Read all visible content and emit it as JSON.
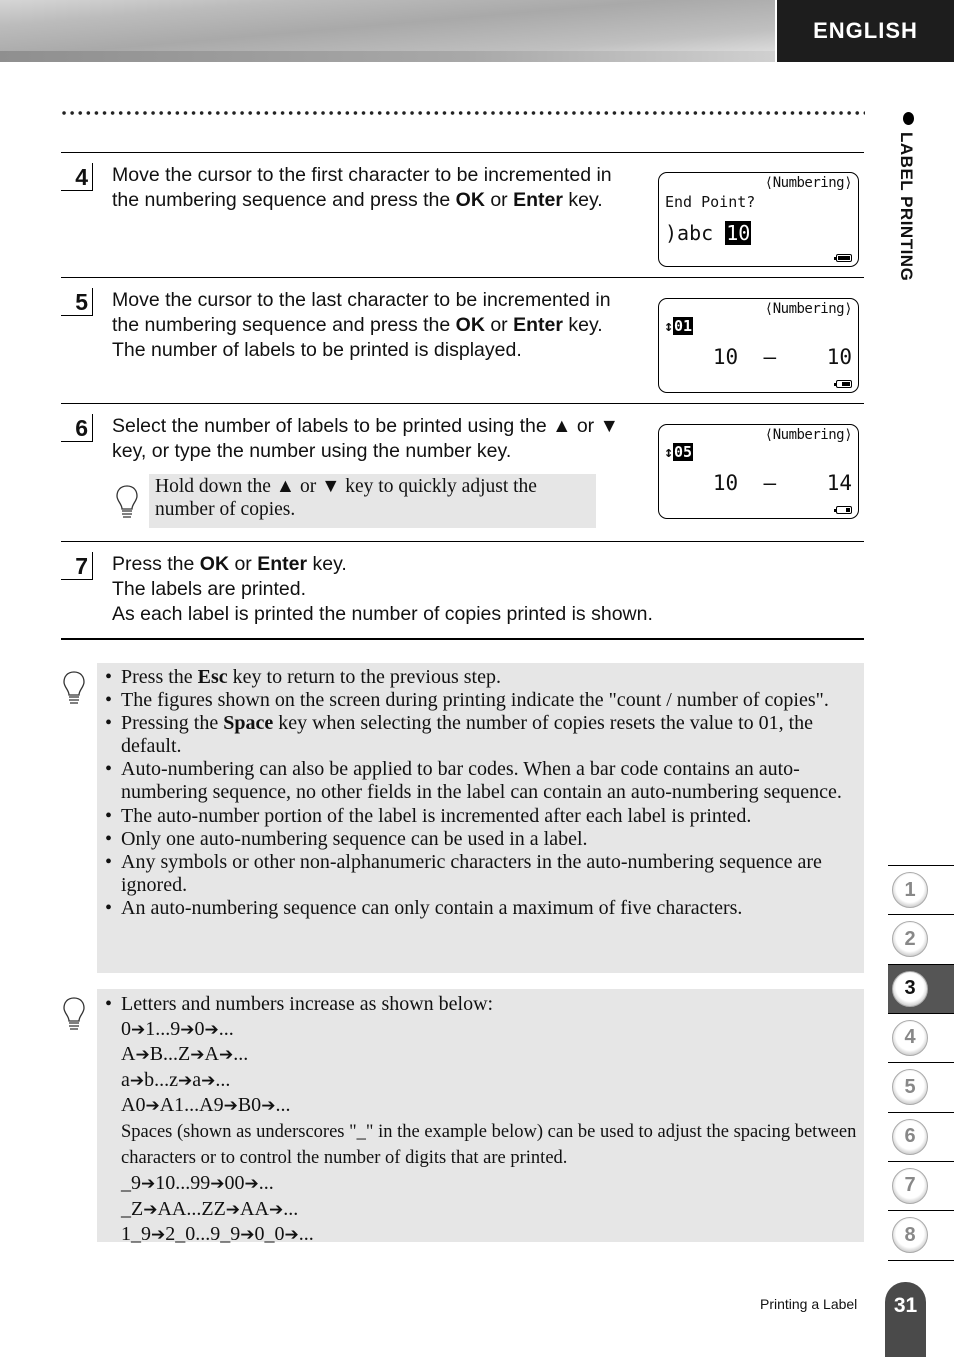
{
  "header": {
    "language_label": "ENGLISH"
  },
  "side": {
    "section_title": "LABEL PRINTING"
  },
  "steps": [
    {
      "number": "4",
      "lines": [
        {
          "parts": [
            {
              "t": "Move the cursor to the first character to be incremented in"
            }
          ]
        },
        {
          "parts": [
            {
              "t": "the numbering sequence and press the "
            },
            {
              "t": "OK",
              "b": true
            },
            {
              "t": " or "
            },
            {
              "t": "Enter",
              "b": true
            },
            {
              "t": " key."
            }
          ]
        }
      ],
      "lcd": {
        "mode": "⟨Numbering⟩",
        "line1": "End Point?",
        "line2_prefix": ")abc ",
        "line2_highlight": "10",
        "battery": "full"
      }
    },
    {
      "number": "5",
      "lines": [
        {
          "parts": [
            {
              "t": "Move the cursor to the last character to be incremented in"
            }
          ]
        },
        {
          "parts": [
            {
              "t": "the numbering sequence and press the "
            },
            {
              "t": "OK",
              "b": true
            },
            {
              "t": " or "
            },
            {
              "t": "Enter",
              "b": true
            },
            {
              "t": " key."
            }
          ]
        },
        {
          "parts": [
            {
              "t": "The number of labels to be printed is displayed."
            }
          ]
        }
      ],
      "lcd": {
        "mode": "⟨Numbering⟩",
        "count": "01",
        "range_start": "10",
        "range_sep": "–",
        "range_end": "10",
        "battery": "half"
      }
    },
    {
      "number": "6",
      "lines": [
        {
          "parts": [
            {
              "t": "Select the number of labels to be printed using the ▲ or ▼"
            }
          ]
        },
        {
          "parts": [
            {
              "t": "key, or type the number using the number key."
            }
          ]
        }
      ],
      "tip": "Hold down the ▲ or ▼ key to quickly adjust the number of copies.",
      "lcd": {
        "mode": "⟨Numbering⟩",
        "count": "05",
        "range_start": "10",
        "range_sep": "–",
        "range_end": "14",
        "battery": "low"
      }
    },
    {
      "number": "7",
      "lines": [
        {
          "parts": [
            {
              "t": "Press the "
            },
            {
              "t": "OK",
              "b": true
            },
            {
              "t": " or "
            },
            {
              "t": "Enter",
              "b": true
            },
            {
              "t": " key."
            }
          ]
        },
        {
          "parts": [
            {
              "t": "The labels are printed."
            }
          ]
        },
        {
          "parts": [
            {
              "t": "As each label is printed the number of copies printed is shown."
            }
          ]
        }
      ]
    }
  ],
  "notes1": [
    {
      "parts": [
        {
          "t": "Press the "
        },
        {
          "t": "Esc",
          "b": true
        },
        {
          "t": " key to return to the previous step."
        }
      ]
    },
    {
      "parts": [
        {
          "t": "The figures shown on the screen during printing indicate the \"count / number of copies\"."
        }
      ]
    },
    {
      "parts": [
        {
          "t": "Pressing the "
        },
        {
          "t": "Space",
          "b": true
        },
        {
          "t": " key when selecting the number of copies resets the value to 01, the default."
        }
      ]
    },
    {
      "parts": [
        {
          "t": "Auto-numbering can also be applied to bar codes. When a bar code contains an auto-numbering sequence, no other fields in the label can contain an auto-numbering sequence."
        }
      ]
    },
    {
      "parts": [
        {
          "t": "The auto-number portion of the label is incremented after each label is printed."
        }
      ]
    },
    {
      "parts": [
        {
          "t": "Only one auto-numbering sequence can be used in a label."
        }
      ]
    },
    {
      "parts": [
        {
          "t": "Any symbols or other non-alphanumeric characters in the auto-numbering sequence are ignored."
        }
      ]
    },
    {
      "parts": [
        {
          "t": "An auto-numbering sequence can only contain a maximum of five characters."
        }
      ]
    }
  ],
  "notes2": {
    "intro": "Letters and numbers increase as shown below:",
    "sequences1": [
      [
        "0",
        "1...9",
        "0",
        "..."
      ],
      [
        "A",
        "B...Z",
        "A",
        "..."
      ],
      [
        "a",
        "b...z",
        "a",
        "..."
      ],
      [
        "A0",
        "A1...A9",
        "B0",
        "..."
      ]
    ],
    "spaces_text": "Spaces (shown as underscores \"_\" in the example below) can be used to adjust the spacing between characters or to control the number of digits that are printed.",
    "sequences2": [
      [
        "_9",
        "10...99",
        "00",
        "..."
      ],
      [
        "_Z",
        "AA...ZZ",
        "AA",
        "..."
      ],
      [
        "1_9",
        "2_0...9_9",
        "0_0",
        "..."
      ]
    ]
  },
  "chapter_tabs": [
    {
      "label": "1",
      "active": false
    },
    {
      "label": "2",
      "active": false
    },
    {
      "label": "3",
      "active": true
    },
    {
      "label": "4",
      "active": false
    },
    {
      "label": "5",
      "active": false
    },
    {
      "label": "6",
      "active": false
    },
    {
      "label": "7",
      "active": false
    },
    {
      "label": "8",
      "active": false
    }
  ],
  "footer": {
    "section_title": "Printing a Label",
    "page_number": "31"
  }
}
